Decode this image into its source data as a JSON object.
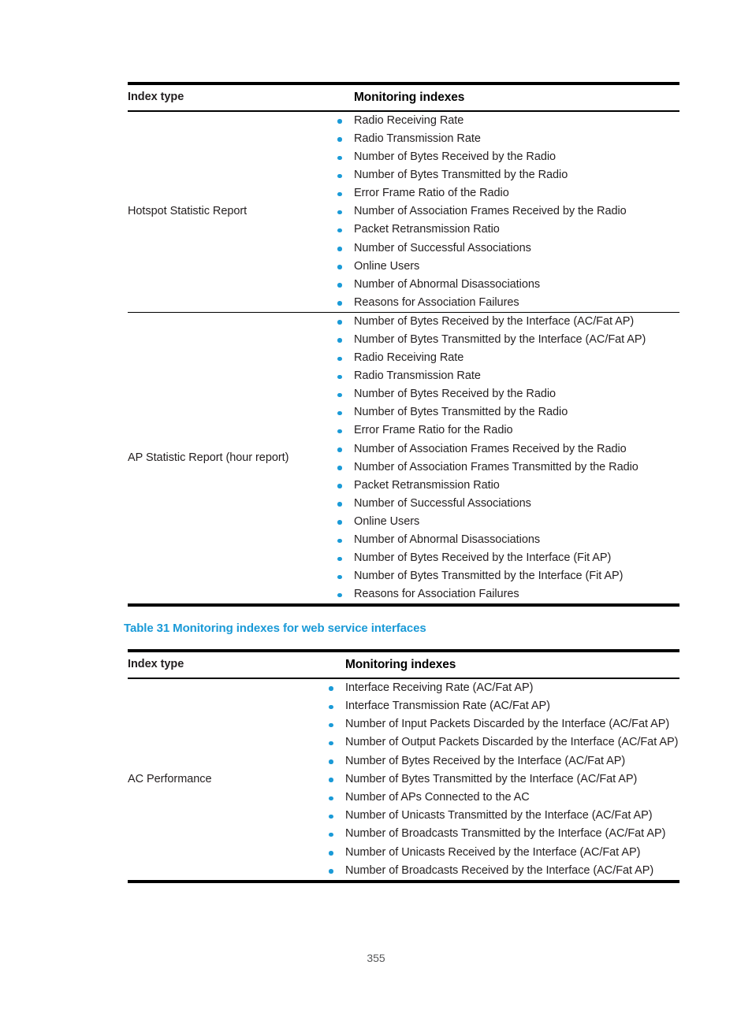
{
  "page": {
    "number": "355"
  },
  "table_a": {
    "headers": {
      "index_type": "Index type",
      "monitoring_indexes": "Monitoring indexes"
    },
    "rows": [
      {
        "index_type": "Hotspot Statistic Report",
        "indexes": [
          "Radio Receiving Rate",
          "Radio Transmission Rate",
          "Number of Bytes Received by the Radio",
          "Number of Bytes Transmitted by the Radio",
          "Error Frame Ratio of the Radio",
          "Number of Association Frames Received by the Radio",
          "Packet Retransmission Ratio",
          "Number of Successful Associations",
          "Online Users",
          "Number of Abnormal Disassociations",
          "Reasons for Association Failures"
        ]
      },
      {
        "index_type": "AP Statistic Report (hour report)",
        "indexes": [
          "Number of Bytes Received by the Interface (AC/Fat AP)",
          "Number of Bytes Transmitted by the Interface (AC/Fat AP)",
          "Radio Receiving Rate",
          "Radio Transmission Rate",
          "Number of Bytes Received by the Radio",
          "Number of Bytes Transmitted by the Radio",
          "Error Frame Ratio for the Radio",
          "Number of Association Frames Received by the Radio",
          "Number of Association Frames Transmitted by the Radio",
          "Packet Retransmission Ratio",
          "Number of Successful Associations",
          "Online Users",
          "Number of Abnormal Disassociations",
          "Number of Bytes Received by the Interface (Fit AP)",
          "Number of Bytes Transmitted by the Interface (Fit AP)",
          "Reasons for Association Failures"
        ]
      }
    ]
  },
  "caption_b": "Table 31 Monitoring indexes for web service interfaces",
  "table_b": {
    "headers": {
      "index_type": "Index type",
      "monitoring_indexes": "Monitoring indexes"
    },
    "rows": [
      {
        "index_type": "AC Performance",
        "indexes": [
          "Interface Receiving Rate (AC/Fat AP)",
          "Interface Transmission Rate (AC/Fat AP)",
          "Number of Input Packets Discarded by the Interface (AC/Fat AP)",
          "Number of Output Packets Discarded by the Interface (AC/Fat AP)",
          "Number of Bytes Received by the Interface (AC/Fat AP)",
          "Number of Bytes Transmitted by the Interface (AC/Fat AP)",
          "Number of APs Connected to the AC",
          "Number of Unicasts Transmitted by the Interface (AC/Fat AP)",
          "Number of Broadcasts Transmitted by the Interface (AC/Fat AP)",
          "Number of Unicasts Received by the Interface (AC/Fat AP)",
          "Number of Broadcasts Received by the Interface (AC/Fat AP)"
        ]
      }
    ]
  },
  "colors": {
    "accent_blue": "#1a9ad7",
    "text": "#231f20",
    "rule": "#000000"
  }
}
